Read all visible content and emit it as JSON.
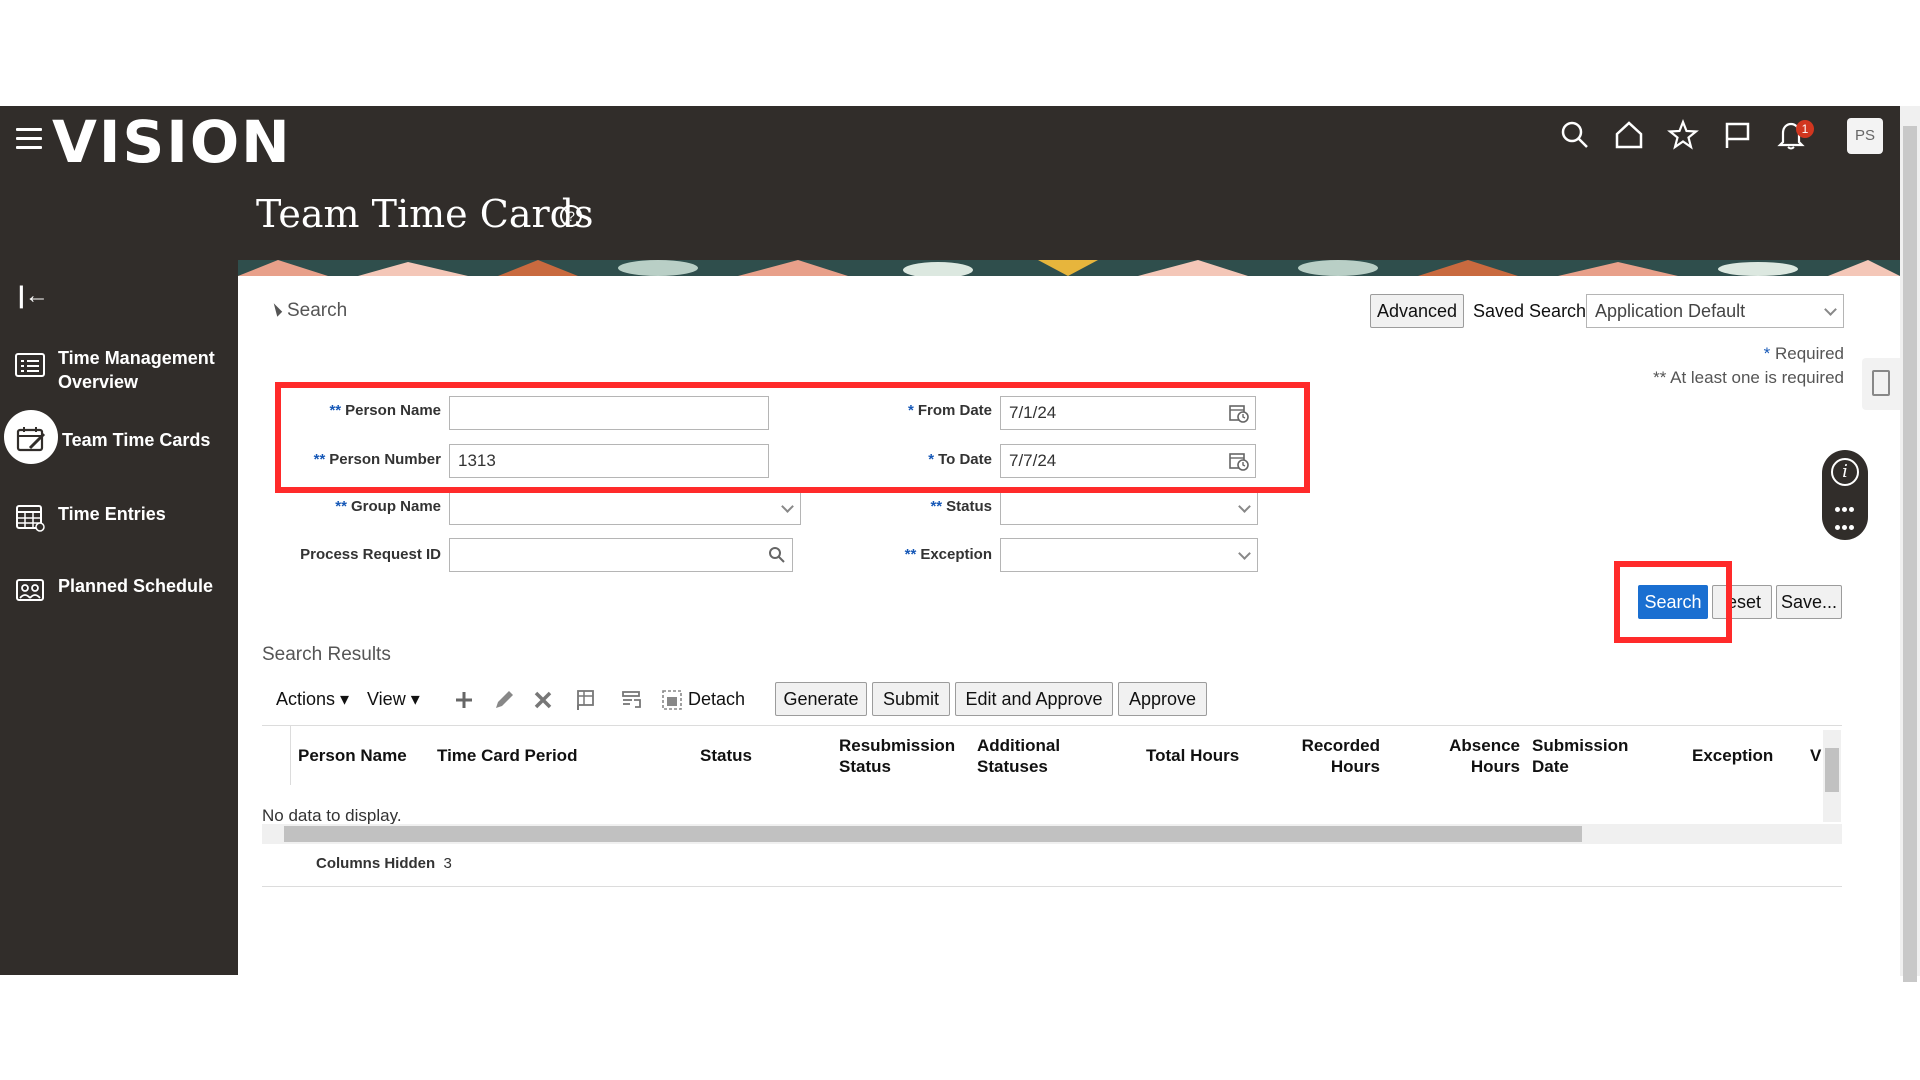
{
  "app": {
    "logo": "VISION",
    "page_title": "Team Time Cards",
    "notification_count": "1",
    "user_initials": "PS"
  },
  "sidebar": {
    "items": [
      {
        "label": "Time Management Overview",
        "icon": "list-icon"
      },
      {
        "label": "Team Time Cards",
        "icon": "calendar-edit-icon"
      },
      {
        "label": "Time Entries",
        "icon": "grid-calendar-icon"
      },
      {
        "label": "Planned Schedule",
        "icon": "group-icon"
      }
    ]
  },
  "search": {
    "section_label": "Search",
    "advanced_label": "Advanced",
    "saved_search_label": "Saved Search",
    "saved_search_value": "Application Default",
    "required_note": "Required",
    "required_star": "*",
    "at_least_one_note": "At least one is required",
    "at_least_one_star": "**",
    "fields": {
      "person_name": {
        "label": "Person Name",
        "marker": "**",
        "value": ""
      },
      "person_number": {
        "label": "Person Number",
        "marker": "**",
        "value": "1313"
      },
      "group_name": {
        "label": "Group Name",
        "marker": "**",
        "value": ""
      },
      "process_request_id": {
        "label": "Process Request ID",
        "marker": "",
        "value": ""
      },
      "from_date": {
        "label": "From Date",
        "marker": "*",
        "value": "7/1/24"
      },
      "to_date": {
        "label": "To Date",
        "marker": "*",
        "value": "7/7/24"
      },
      "status": {
        "label": "Status",
        "marker": "**",
        "value": ""
      },
      "exception": {
        "label": "Exception",
        "marker": "**",
        "value": ""
      }
    },
    "buttons": {
      "search": "Search",
      "reset": "eset",
      "save": "Save..."
    }
  },
  "results": {
    "label": "Search Results",
    "toolbar": {
      "actions": "Actions",
      "view": "View",
      "detach": "Detach",
      "generate": "Generate",
      "submit": "Submit",
      "edit_and_approve": "Edit and Approve",
      "approve": "Approve"
    },
    "columns": {
      "person_name": "Person Name",
      "time_card_period": "Time Card Period",
      "status": "Status",
      "resubmission_status_1": "Resubmission",
      "resubmission_status_2": "Status",
      "additional_statuses_1": "Additional",
      "additional_statuses_2": "Statuses",
      "total_hours": "Total Hours",
      "recorded_hours_1": "Recorded",
      "recorded_hours_2": "Hours",
      "absence_hours_1": "Absence",
      "absence_hours_2": "Hours",
      "submission_date_1": "Submission",
      "submission_date_2": "Date",
      "exception": "Exception",
      "next_partial": "V"
    },
    "empty_text": "No data to display.",
    "columns_hidden_label": "Columns Hidden",
    "columns_hidden_count": "3"
  },
  "colors": {
    "header_bg": "#312d2a",
    "primary_button": "#1a6fd1",
    "highlight": "#ff2a2a",
    "required_marker": "#1658b7"
  }
}
